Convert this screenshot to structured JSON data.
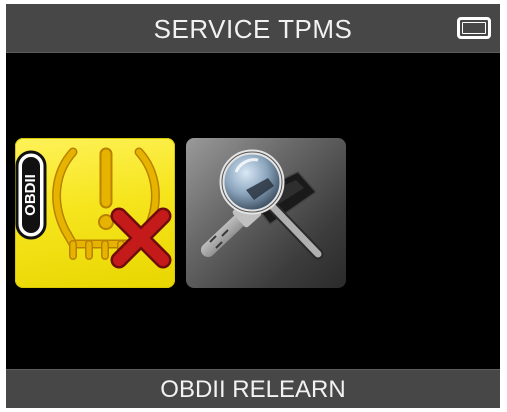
{
  "header": {
    "title": "SERVICE TPMS",
    "battery_icon": "battery-icon"
  },
  "menu": {
    "tiles": [
      {
        "id": "obdii-relearn",
        "icon": "obdii-tpms-warning-icon",
        "badge_text": "OBDII",
        "selected": true,
        "color": "#f4e41c"
      },
      {
        "id": "sensor-inspection",
        "icon": "tpms-sensor-magnifier-icon",
        "selected": false,
        "color": "#6a6a6a"
      }
    ]
  },
  "footer": {
    "label": "OBDII RELEARN"
  },
  "colors": {
    "screen_bg": "#000000",
    "bar_bg": "#474747",
    "text": "#f2f2f2",
    "tpms_amber": "#e2a800",
    "error_red": "#c41a1a"
  }
}
